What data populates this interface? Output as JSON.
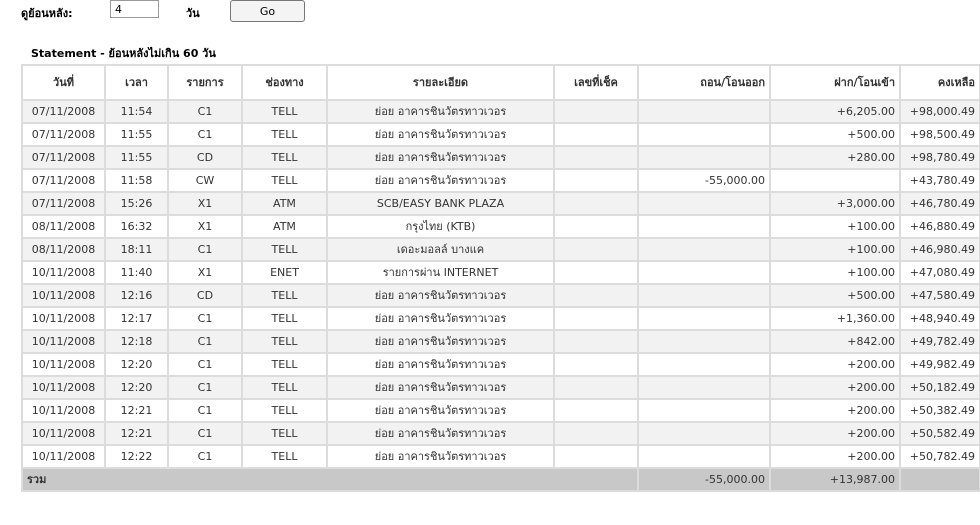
{
  "controls": {
    "back_label": "ดูย้อนหลัง:",
    "days_value": "4",
    "unit_label": "วัน",
    "go_label": "Go"
  },
  "statement_title": "Statement - ย้อนหลังไม่เกิน 60 วัน",
  "columns": [
    "วันที่",
    "เวลา",
    "รายการ",
    "ช่องทาง",
    "รายละเอียด",
    "เลขที่เช็ค",
    "ถอน/โอนออก",
    "ฝาก/โอนเข้า",
    "คงเหลือ"
  ],
  "rows": [
    {
      "date": "07/11/2008",
      "time": "11:54",
      "type": "C1",
      "channel": "TELL",
      "detail": "ย่อย อาคารชินวัตรทาวเวอร",
      "cheque": "",
      "withdraw": "",
      "deposit": "+6,205.00",
      "balance": "+98,000.49"
    },
    {
      "date": "07/11/2008",
      "time": "11:55",
      "type": "C1",
      "channel": "TELL",
      "detail": "ย่อย อาคารชินวัตรทาวเวอร",
      "cheque": "",
      "withdraw": "",
      "deposit": "+500.00",
      "balance": "+98,500.49"
    },
    {
      "date": "07/11/2008",
      "time": "11:55",
      "type": "CD",
      "channel": "TELL",
      "detail": "ย่อย อาคารชินวัตรทาวเวอร",
      "cheque": "",
      "withdraw": "",
      "deposit": "+280.00",
      "balance": "+98,780.49"
    },
    {
      "date": "07/11/2008",
      "time": "11:58",
      "type": "CW",
      "channel": "TELL",
      "detail": "ย่อย อาคารชินวัตรทาวเวอร",
      "cheque": "",
      "withdraw": "-55,000.00",
      "deposit": "",
      "balance": "+43,780.49"
    },
    {
      "date": "07/11/2008",
      "time": "15:26",
      "type": "X1",
      "channel": "ATM",
      "detail": "SCB/EASY BANK PLAZA",
      "cheque": "",
      "withdraw": "",
      "deposit": "+3,000.00",
      "balance": "+46,780.49"
    },
    {
      "date": "08/11/2008",
      "time": "16:32",
      "type": "X1",
      "channel": "ATM",
      "detail": "กรุงไทย (KTB)",
      "cheque": "",
      "withdraw": "",
      "deposit": "+100.00",
      "balance": "+46,880.49"
    },
    {
      "date": "08/11/2008",
      "time": "18:11",
      "type": "C1",
      "channel": "TELL",
      "detail": "เดอะมอลล์ บางแค",
      "cheque": "",
      "withdraw": "",
      "deposit": "+100.00",
      "balance": "+46,980.49"
    },
    {
      "date": "10/11/2008",
      "time": "11:40",
      "type": "X1",
      "channel": "ENET",
      "detail": "รายการผ่าน INTERNET",
      "cheque": "",
      "withdraw": "",
      "deposit": "+100.00",
      "balance": "+47,080.49"
    },
    {
      "date": "10/11/2008",
      "time": "12:16",
      "type": "CD",
      "channel": "TELL",
      "detail": "ย่อย อาคารชินวัตรทาวเวอร",
      "cheque": "",
      "withdraw": "",
      "deposit": "+500.00",
      "balance": "+47,580.49"
    },
    {
      "date": "10/11/2008",
      "time": "12:17",
      "type": "C1",
      "channel": "TELL",
      "detail": "ย่อย อาคารชินวัตรทาวเวอร",
      "cheque": "",
      "withdraw": "",
      "deposit": "+1,360.00",
      "balance": "+48,940.49"
    },
    {
      "date": "10/11/2008",
      "time": "12:18",
      "type": "C1",
      "channel": "TELL",
      "detail": "ย่อย อาคารชินวัตรทาวเวอร",
      "cheque": "",
      "withdraw": "",
      "deposit": "+842.00",
      "balance": "+49,782.49"
    },
    {
      "date": "10/11/2008",
      "time": "12:20",
      "type": "C1",
      "channel": "TELL",
      "detail": "ย่อย อาคารชินวัตรทาวเวอร",
      "cheque": "",
      "withdraw": "",
      "deposit": "+200.00",
      "balance": "+49,982.49"
    },
    {
      "date": "10/11/2008",
      "time": "12:20",
      "type": "C1",
      "channel": "TELL",
      "detail": "ย่อย อาคารชินวัตรทาวเวอร",
      "cheque": "",
      "withdraw": "",
      "deposit": "+200.00",
      "balance": "+50,182.49"
    },
    {
      "date": "10/11/2008",
      "time": "12:21",
      "type": "C1",
      "channel": "TELL",
      "detail": "ย่อย อาคารชินวัตรทาวเวอร",
      "cheque": "",
      "withdraw": "",
      "deposit": "+200.00",
      "balance": "+50,382.49"
    },
    {
      "date": "10/11/2008",
      "time": "12:21",
      "type": "C1",
      "channel": "TELL",
      "detail": "ย่อย อาคารชินวัตรทาวเวอร",
      "cheque": "",
      "withdraw": "",
      "deposit": "+200.00",
      "balance": "+50,582.49"
    },
    {
      "date": "10/11/2008",
      "time": "12:22",
      "type": "C1",
      "channel": "TELL",
      "detail": "ย่อย อาคารชินวัตรทาวเวอร",
      "cheque": "",
      "withdraw": "",
      "deposit": "+200.00",
      "balance": "+50,782.49"
    }
  ],
  "total": {
    "label": "รวม",
    "withdraw": "-55,000.00",
    "deposit": "+13,987.00"
  }
}
